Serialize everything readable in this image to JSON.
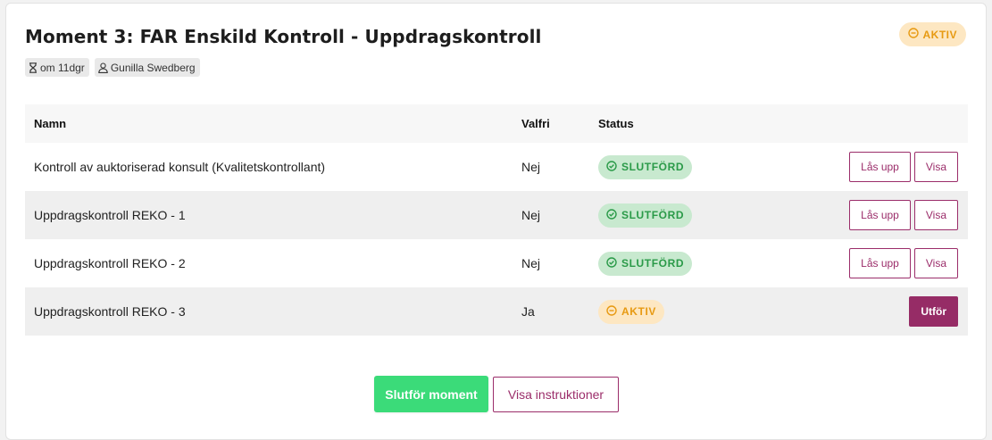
{
  "moment": {
    "title": "Moment 3: FAR Enskild Kontroll - Uppdragskontroll",
    "status_label": "AKTIV",
    "due_label": "om 11dgr",
    "assignee": "Gunilla Swedberg"
  },
  "table": {
    "headers": {
      "name": "Namn",
      "optional": "Valfri",
      "status": "Status"
    },
    "rows": [
      {
        "name": "Kontroll av auktoriserad konsult (Kvalitetskontrollant)",
        "optional": "Nej",
        "status": "SLUTFÖRD",
        "state": "done",
        "actions": [
          "Lås upp",
          "Visa"
        ]
      },
      {
        "name": "Uppdragskontroll REKO - 1",
        "optional": "Nej",
        "status": "SLUTFÖRD",
        "state": "done",
        "actions": [
          "Lås upp",
          "Visa"
        ]
      },
      {
        "name": "Uppdragskontroll REKO - 2",
        "optional": "Nej",
        "status": "SLUTFÖRD",
        "state": "done",
        "actions": [
          "Lås upp",
          "Visa"
        ]
      },
      {
        "name": "Uppdragskontroll REKO - 3",
        "optional": "Ja",
        "status": "AKTIV",
        "state": "active",
        "actions": [
          "Utför"
        ]
      }
    ]
  },
  "footer": {
    "complete_label": "Slutför moment",
    "instructions_label": "Visa instruktioner"
  },
  "colors": {
    "brand": "#962c66",
    "done": "#2a9a48",
    "active": "#e79a12",
    "complete_button": "#3bdb79"
  }
}
